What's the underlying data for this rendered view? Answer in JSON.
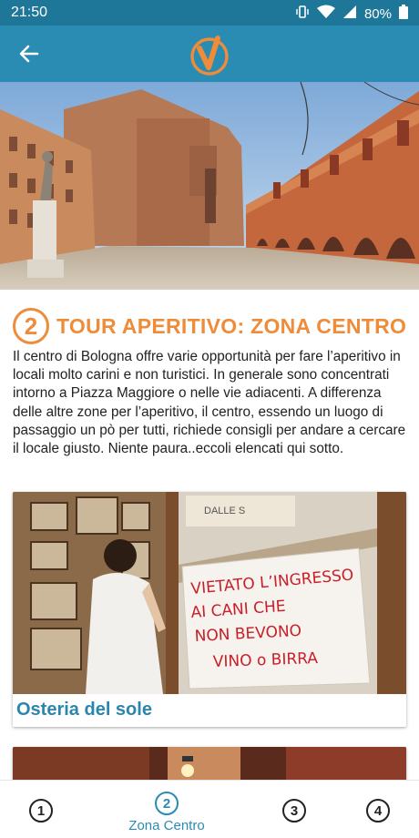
{
  "status_bar": {
    "time": "21:50",
    "battery": "80%",
    "icons": [
      "vibrate-icon",
      "wifi-icon",
      "signal-icon",
      "battery-icon"
    ]
  },
  "app_bar": {
    "back_icon": "arrow-left-icon",
    "logo": "v-check-logo"
  },
  "hero": {
    "image": "piazza-maggiore-photo"
  },
  "section": {
    "number": "2",
    "title": "TOUR APERITIVO: ZONA CENTRO",
    "intro": "Il centro di Bologna offre varie opportunità per fare l’aperitivo in locali molto carini e non turistici. In generale sono concentrati intorno a Piazza Maggiore o nelle vie adiacenti. A differenza delle altre zone per l’aperitivo, il centro, essendo un luogo di passaggio un pò per tutti, richiede consigli per andare a cercare il locale giusto. Niente paura..eccoli elencati qui sotto."
  },
  "cards": [
    {
      "title": "Osteria del sole",
      "image": "osteria-del-sole-photo",
      "sign_text": [
        "VIETATO L’INGRESSO",
        "AI CANI CHE",
        "NON BEVONO",
        "VINO o BIRRA"
      ],
      "paper_text": "DALLE S"
    },
    {
      "title": "",
      "image": "bar-interior-photo"
    }
  ],
  "tabs": [
    {
      "number": "1",
      "label": "",
      "active": false
    },
    {
      "number": "2",
      "label": "Zona Centro",
      "active": true
    },
    {
      "number": "3",
      "label": "",
      "active": false
    },
    {
      "number": "4",
      "label": "",
      "active": false
    }
  ],
  "colors": {
    "status_bar": "#1e7799",
    "app_bar": "#2a8bb3",
    "accent_orange": "#ee8c3a",
    "link_blue": "#2a86ad"
  }
}
